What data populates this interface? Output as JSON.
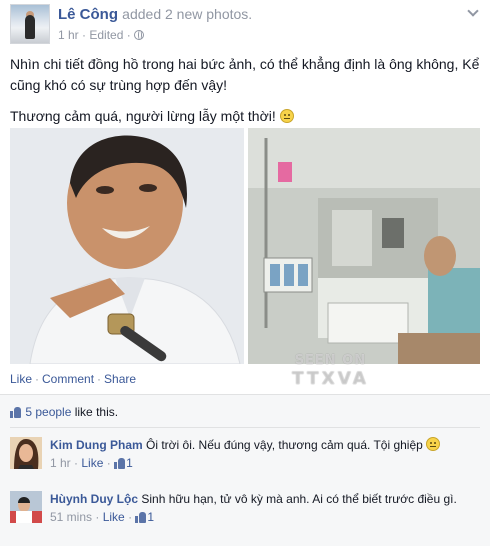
{
  "post": {
    "author": "Lê Công",
    "action": "added 2 new photos.",
    "time": "1 hr",
    "edited": "Edited",
    "meta_separator": "·",
    "paragraphs": [
      "Nhìn chi tiết đồng hồ trong hai bức ảnh, có thể khẳng định là ông không, Kể cũng khó có sự trùng hợp đến vậy!",
      "Thương cảm quá, người lừng lẫy một thời!"
    ],
    "icons": [
      "globe-icon",
      "chevron-down-icon",
      "smile-emoticon-icon"
    ]
  },
  "photos": {
    "watermark_line1": "SEEN ON",
    "watermark_line2": "TTXVA"
  },
  "actions": {
    "like": "Like",
    "comment": "Comment",
    "share": "Share",
    "separator": "·"
  },
  "likes": {
    "count_text": "5 people",
    "suffix": " like this."
  },
  "comments": [
    {
      "author": "Kim Dung Pham",
      "text": "Ôi trời ôi. Nếu đúng vậy, thương cảm quá. Tội ghiệp",
      "time": "1 hr",
      "like_label": "Like",
      "like_count": "1"
    },
    {
      "author": "Hùynh Duy Lộc",
      "text": "Sinh hữu hạn, tử vô kỳ mà anh. Ai có thể biết trước điều gì.",
      "time": "51 mins",
      "like_label": "Like",
      "like_count": "1"
    }
  ],
  "colors": {
    "link": "#3b5998",
    "muted": "#9197a3",
    "text": "#141823",
    "ufi_background": "#f6f7f8"
  }
}
